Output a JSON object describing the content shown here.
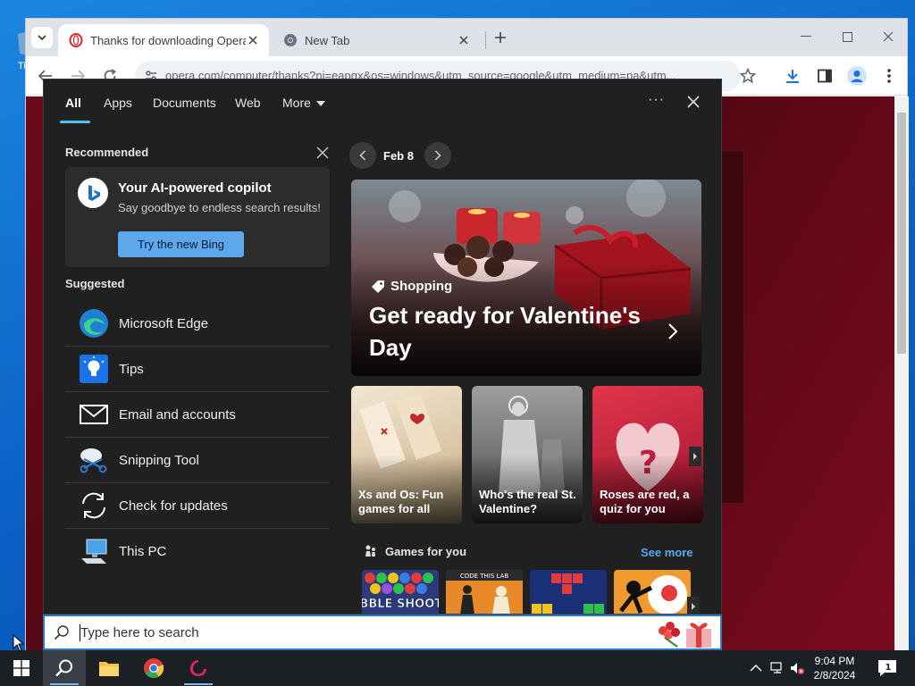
{
  "desktop": {
    "icon_label": "Ti"
  },
  "browser": {
    "tabs": [
      {
        "title": "Thanks for downloading Opera",
        "active": true,
        "favicon": "opera-icon"
      },
      {
        "title": "New Tab",
        "active": false,
        "favicon": "chrome-icon"
      }
    ],
    "url": "opera.com/computer/thanks?ni=eapgx&os=windows&utm_source=google&utm_medium=pa&utm..."
  },
  "start_menu": {
    "nav": {
      "all": "All",
      "apps": "Apps",
      "documents": "Documents",
      "web": "Web",
      "more": "More"
    },
    "recommended": {
      "title": "Recommended",
      "card_title": "Your AI-powered copilot",
      "card_subtitle": "Say goodbye to endless search results!",
      "button": "Try the new Bing"
    },
    "suggested": {
      "title": "Suggested",
      "items": [
        {
          "label": "Microsoft Edge",
          "icon": "edge-icon"
        },
        {
          "label": "Tips",
          "icon": "tips-icon"
        },
        {
          "label": "Email and accounts",
          "icon": "mail-icon"
        },
        {
          "label": "Snipping Tool",
          "icon": "snipping-tool-icon"
        },
        {
          "label": "Check for updates",
          "icon": "refresh-icon"
        },
        {
          "label": "This PC",
          "icon": "computer-icon"
        }
      ]
    },
    "feed": {
      "date": "Feb 8",
      "hero": {
        "category": "Shopping",
        "headline": "Get ready for Valentine's Day"
      },
      "cards": [
        {
          "caption": "Xs and Os: Fun games for all"
        },
        {
          "caption": "Who's the real St. Valentine?"
        },
        {
          "caption": "Roses are red, a quiz for you"
        }
      ],
      "games": {
        "title": "Games for you",
        "see_more": "See more",
        "tile1_text": "BUBBLE SHOOTER",
        "tile2_text": "CODE THIS LAB"
      }
    }
  },
  "search": {
    "placeholder": "Type here to search"
  },
  "taskbar": {
    "time": "9:04 PM",
    "date": "2/8/2024",
    "notification_count": "1"
  },
  "colors": {
    "accent": "#4cc2ff",
    "button": "#5da7ec",
    "panel": "#202020"
  }
}
